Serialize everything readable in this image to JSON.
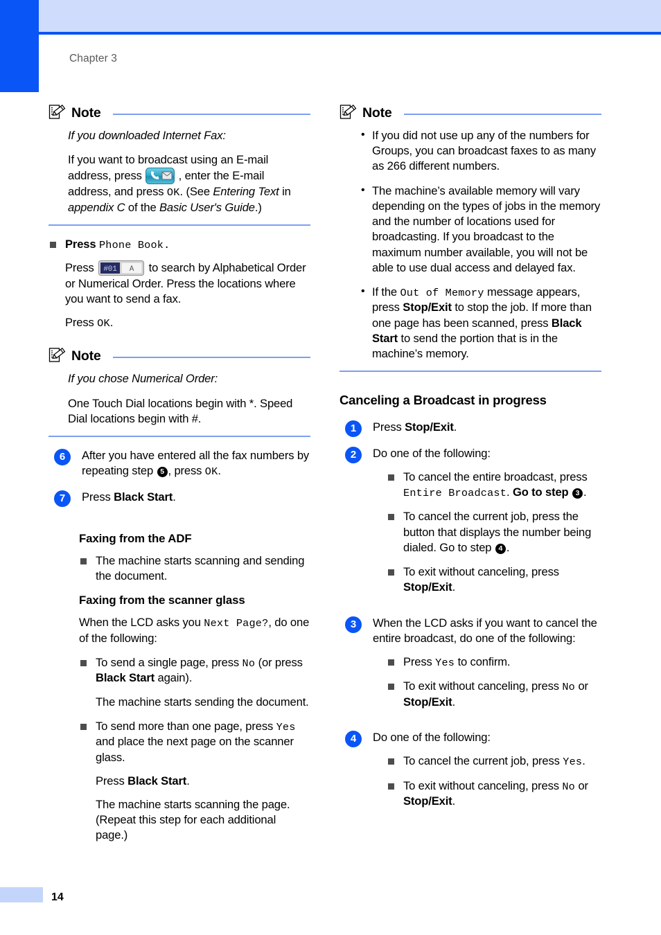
{
  "page": {
    "chapter_label": "Chapter 3",
    "page_number": "14",
    "accent_blue": "#0a55f5",
    "header_band": "#cfdcfb",
    "rule_blue": "#7d9ff0"
  },
  "note_word": "Note",
  "left_column": {
    "note1": {
      "subtitle": "If you downloaded Internet Fax:",
      "para_a1": "If you want to broadcast using an E-mail",
      "para_a2": "address, press",
      "para_a3": ", enter the E-mail",
      "para_b1": "address, and press",
      "para_b_mono": "OK",
      "para_b2": ". (See ",
      "para_b_it1": "Entering Text",
      "para_b3": " in ",
      "para_b_it2": "appendix C",
      "para_b4": " of the ",
      "para_b_it3": "Basic User's Guide",
      "para_b5": ".)"
    },
    "phone_book_item": {
      "press_label": "Press",
      "phone_book_mono": "Phone Book.",
      "press2_label": "Press",
      "search_text": "to search by Alphabetical Order or Numerical Order. Press the locations where you want to send a fax.",
      "press_ok_label": "Press",
      "ok_mono": "OK",
      "ok_period": "."
    },
    "note2": {
      "subtitle": "If you chose Numerical Order:",
      "body": "One Touch Dial locations begin with *. Speed Dial locations begin with #."
    },
    "step6": {
      "num": "6",
      "text_a": "After you have entered all the fax numbers by repeating step",
      "inline_step": "5",
      "text_b": ", press",
      "mono_ok": "OK",
      "text_c": "."
    },
    "step7": {
      "num": "7",
      "text_a": "Press",
      "bold": "Black Start",
      "text_b": "."
    },
    "adf_heading": "Faxing from the ADF",
    "adf_bullet": "The machine starts scanning and sending the document.",
    "glass_heading": "Faxing from the scanner glass",
    "glass_intro_a": "When the LCD asks you",
    "glass_intro_mono": "Next Page?",
    "glass_intro_b": ", do one of the following:",
    "glass_b1": {
      "a": "To send a single page, press",
      "mono": "No",
      "b": "(or press",
      "bold": "Black Start",
      "c": "again).",
      "follow": "The machine starts sending the document."
    },
    "glass_b2": {
      "a": "To send more than one page, press",
      "mono": "Yes",
      "b": "and place the next page on the scanner glass.",
      "press_a": "Press",
      "press_bold": "Black Start",
      "press_b": ".",
      "follow": "The machine starts scanning the page. (Repeat this step for each additional page.)"
    }
  },
  "right_column": {
    "note1_bullets": [
      "If you did not use up any of the numbers for Groups, you can broadcast faxes to as many as 266 different numbers.",
      "The machine’s available memory will vary depending on the types of jobs in the memory and the number of locations used for broadcasting. If you broadcast to the maximum number available, you will not be able to use dual access and delayed fax."
    ],
    "note1_bullet3": {
      "a": "If the",
      "mono": "Out of Memory",
      "b": "message appears, press",
      "bold1": "Stop/Exit",
      "c": "to stop the job. If more than one page has been scanned, press",
      "bold2": "Black Start",
      "d": "to send the portion that is in the machine’s memory."
    },
    "section_heading": "Canceling a Broadcast in progress",
    "step1": {
      "num": "1",
      "a": "Press",
      "bold": "Stop/Exit",
      "b": "."
    },
    "step2": {
      "num": "2",
      "intro": "Do one of the following:",
      "b1": {
        "a": "To cancel the entire broadcast, press",
        "mono": "Entire Broadcast",
        "b": ".",
        "goto": "Go to step",
        "circ": "3",
        "end": "."
      },
      "b2": {
        "a": "To cancel the current job, press the button that displays the number being dialed. Go to step",
        "circ": "4",
        "end": "."
      },
      "b3": {
        "a": "To exit without canceling, press",
        "bold": "Stop/Exit",
        "b": "."
      }
    },
    "step3": {
      "num": "3",
      "intro": "When the LCD asks if you want to cancel the entire broadcast, do one of the following:",
      "b1": {
        "a": "Press",
        "mono": "Yes",
        "b": "to confirm."
      },
      "b2": {
        "a": "To exit without canceling, press",
        "mono": "No",
        "b": "or",
        "bold": "Stop/Exit",
        "c": "."
      }
    },
    "step4": {
      "num": "4",
      "intro": "Do one of the following:",
      "b1": {
        "a": "To cancel the current job, press",
        "mono": "Yes",
        "b": "."
      },
      "b2": {
        "a": "To exit without canceling, press",
        "mono": "No",
        "b": "or",
        "bold": "Stop/Exit",
        "c": "."
      }
    }
  },
  "icons": {
    "note": "note-pencil-icon",
    "phone_mail_button": "phone-email-button-icon",
    "alpha_numeric_toggle": "alpha-numeric-toggle-button-icon"
  }
}
